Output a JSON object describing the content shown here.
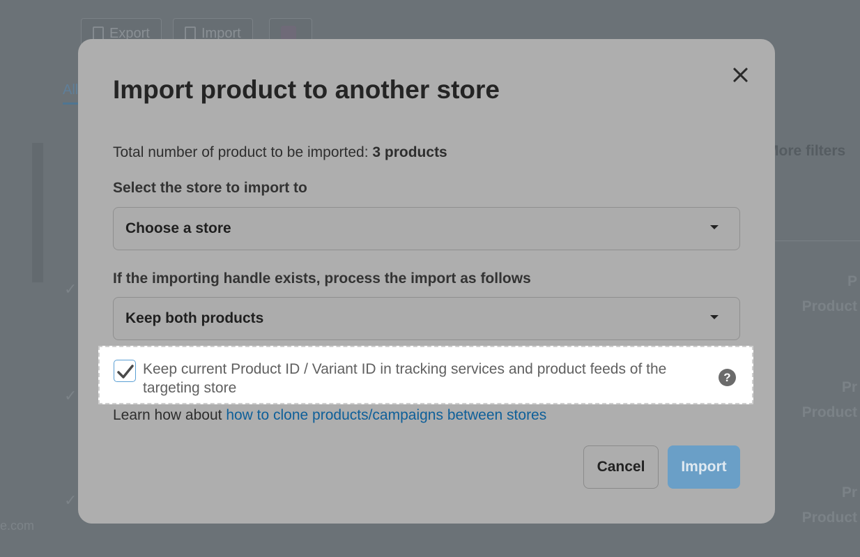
{
  "background": {
    "toolbar": {
      "export_label": "Export",
      "import_label": "Import"
    },
    "tab_label": "All",
    "filters_label": "More filters",
    "rows": [
      {
        "line1": "P",
        "line2": "Product"
      },
      {
        "line1": "Pr",
        "line2": "Product"
      },
      {
        "line1": "Pr",
        "line2": "Product"
      }
    ],
    "footer_text": "e.com"
  },
  "modal": {
    "title": "Import product to another store",
    "total_prefix": "Total number of product to be imported:",
    "total_value": "3 products",
    "store_label": "Select the store to import to",
    "store_select_value": "Choose a store",
    "handle_label": "If the importing handle exists, process the import as follows",
    "handle_select_value": "Keep both products",
    "keep_ids_checked": true,
    "keep_ids_text": "Keep current Product ID / Variant ID in tracking services and product feeds of the targeting store",
    "help_icon": "question-circle-icon",
    "learn_prefix": "Learn how about",
    "learn_link": "how to clone products/campaigns between stores",
    "cancel_label": "Cancel",
    "import_label": "Import"
  },
  "colors": {
    "overlay": "#6b7277",
    "modal_bg": "#aeaeae",
    "link": "#0e5f99",
    "primary_button": "#6a9fc7"
  }
}
